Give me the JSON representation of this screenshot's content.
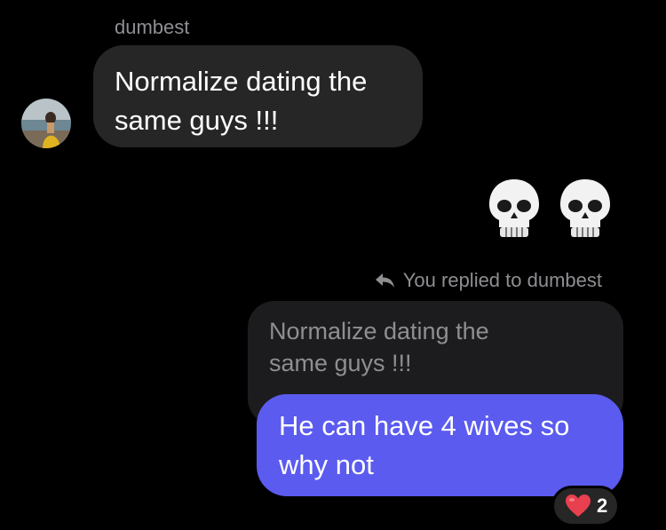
{
  "colors": {
    "background": "#000000",
    "incoming_bubble": "#262626",
    "quoted_bubble": "#1c1c1e",
    "outgoing_bubble": "#5b5bf0",
    "muted_text": "#8e8e93",
    "reaction_heart": "#e8404f"
  },
  "incoming": {
    "sender": "dumbest",
    "avatar_icon": "profile-photo-avatar",
    "line1": "Normalize dating the",
    "line2": "same guys !!!"
  },
  "reactions_sent": {
    "icon": "skull-emoji",
    "items": [
      "💀",
      "💀"
    ]
  },
  "reply": {
    "icon": "reply-arrow-icon",
    "label": "You replied to dumbest",
    "quoted_line1": "Normalize dating the",
    "quoted_line2": "same guys !!!"
  },
  "outgoing": {
    "line1": "He can have 4 wives so",
    "line2": "why not"
  },
  "reaction": {
    "icon": "red-heart-emoji",
    "count": "2"
  }
}
